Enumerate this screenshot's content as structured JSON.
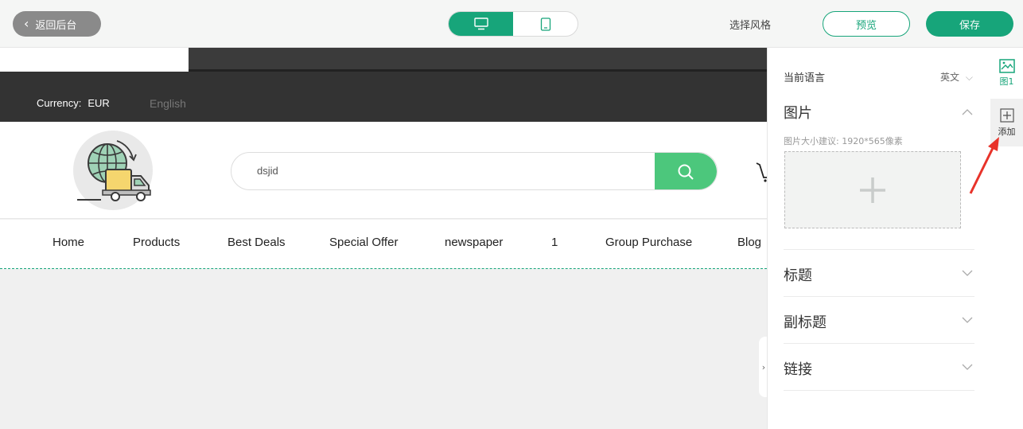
{
  "toolbar": {
    "back_label": "返回后台",
    "style_label": "选择风格",
    "preview_label": "预览",
    "save_label": "保存",
    "devices": [
      "desktop-icon",
      "tablet-icon"
    ],
    "active_device": "desktop"
  },
  "site_preview": {
    "currency_label": "Currency:",
    "currency_value": "EUR",
    "language": "English",
    "search_text": "dsjid",
    "menu": [
      "Home",
      "Products",
      "Best Deals",
      "Special Offer",
      "newspaper",
      "1",
      "Group Purchase",
      "Blog"
    ]
  },
  "panel": {
    "language_label": "当前语言",
    "language_value": "英文",
    "image_section": "图片",
    "image_hint": "图片大小建议: 1920*565像素",
    "title_section": "标题",
    "subtitle_section": "副标题",
    "link_section": "链接"
  },
  "mini_toolbar": {
    "image_tab": "图1",
    "add_label": "添加"
  },
  "colors": {
    "accent": "#17a57a",
    "search_button": "#4cc77c",
    "dark_bar": "#333333",
    "arrow": "#e8332a"
  }
}
